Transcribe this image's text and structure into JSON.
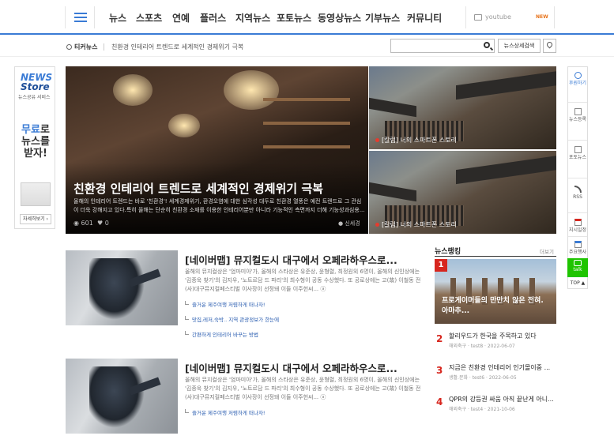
{
  "nav": {
    "items": [
      "뉴스",
      "스포츠",
      "연예",
      "플러스",
      "지역뉴스",
      "포토뉴스",
      "동영상뉴스",
      "기부뉴스",
      "커뮤니티"
    ],
    "youtube_label": "youtube",
    "youtube_badge": "NEW"
  },
  "ticker": {
    "heading": "티커뉴스",
    "text": "친환경 인테리어 트렌드로 세계적인 경제위기 극복"
  },
  "search": {
    "placeholder": "",
    "advanced_label": "뉴스상세검색"
  },
  "store_banner": {
    "line1": "NEWS",
    "line2": "Store",
    "subtitle": "뉴스공유 서비스",
    "promo_highlight": "무료",
    "promo_rest": "로 뉴스를 받자!",
    "button": "자세히보기 ›"
  },
  "hero": {
    "title": "친환경 인테리어 트렌드로 세계적인 경제위기 극복",
    "description": "올해의 인테리어 트렌드는 바로 '친환경'! 세계경제위기, 환경오염에 대한 심각성 대두로 친환경 열풍은 예전 트렌드로 그 관심이 더욱 강해지고 있다.특히 올해는 단순히 친환경 소재를 이용한 인테리어뿐만 아니라 기능적인 측면까지 더해 기능성과심용...",
    "views": "601",
    "likes": "0",
    "author": "신세경"
  },
  "side_cards": [
    {
      "caption": "[칼럼] 너의 스마트폰 스토리"
    },
    {
      "caption": "[칼럼] 너의 스마트폰 스토리"
    }
  ],
  "quick_bar": [
    {
      "label": "후원하기"
    },
    {
      "label": "뉴스등록"
    },
    {
      "label": "포토뉴스"
    },
    {
      "label": "RSS"
    },
    {
      "label": "지시일정"
    },
    {
      "label": "주요행사"
    }
  ],
  "quick_talk": "talk",
  "quick_top": "TOP ▲",
  "articles": [
    {
      "title": "[네이버맵] 뮤지컬도시 대구에서 오페라하우스로...",
      "description": "올해의 뮤지컬상은 '엄마미아'가, 올해의 스타상은 유준상, 윤형렬, 최정원외 6명이, 올해의 신인상에는 '김종욱 찾기'의 김지우, '노트르담 드 파리'의 최수형이 공동 수상했다. 또 공로상에는 고(故) 이철동 전 (사)대구뮤지컬페스티벌 이사장이 선정돼 이들 이주헌씨... ⓐ",
      "related": [
        "즐거운 제주여행 저렴하게 떠나자!",
        "맛집,레저,숙박.. 지역 관광정보가 한눈에",
        "간편하게 인테리어 바꾸는 방법"
      ]
    },
    {
      "title": "[네이버맵] 뮤지컬도시 대구에서 오페라하우스로...",
      "description": "올해의 뮤지컬상은 '엄마미아'가, 올해의 스타상은 유준상, 윤형렬, 최정원외 6명이, 올해의 신인상에는 '김종욱 찾기'의 김지우, '노트르담 드 파리'의 최수형이 공동 수상했다. 또 공로상에는 고(故) 이철동 전 (사)대구뮤지컬페스티벌 이사장이 선정돼 이들 이주헌씨... ⓐ",
      "related": [
        "즐거운 제주여행 저렴하게 떠나자!"
      ]
    }
  ],
  "ranking": {
    "heading": "뉴스랭킹",
    "more": "더보기",
    "top": {
      "rank": "1",
      "title": "프로게이머들의 만만치 않은 전혀. 아마추..."
    },
    "items": [
      {
        "rank": "2",
        "title": "할리우드가 한국을 주목하고 있다",
        "meta": "해외축구 · test8 · 2022-06-07"
      },
      {
        "rank": "3",
        "title": "지금은 친환경 인테리어 인기몰이중 ...",
        "meta": "생활.문화 · test6 · 2022-06-05"
      },
      {
        "rank": "4",
        "title": "QPR의 강등권 싸움 아직 끝난게 아니...",
        "meta": "해외축구 · test4 · 2021-10-06"
      }
    ]
  }
}
